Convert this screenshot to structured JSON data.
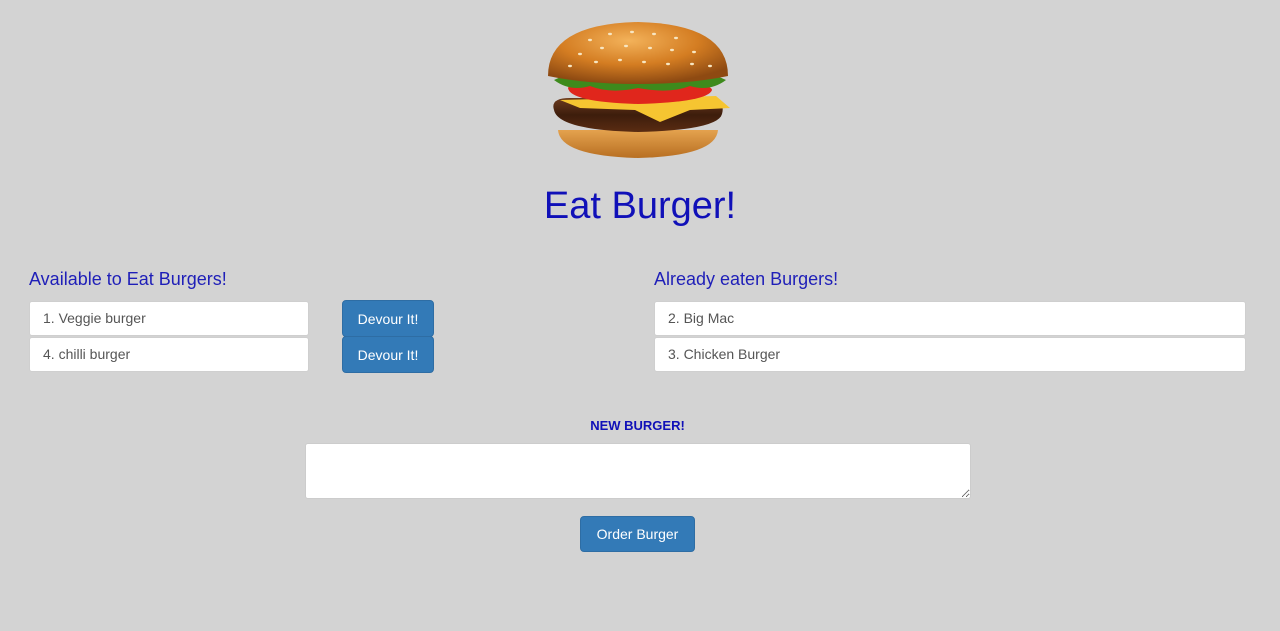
{
  "header": {
    "logo_icon": "burger-icon",
    "title": "Eat Burger!"
  },
  "available": {
    "heading": "Available to Eat Burgers!",
    "items": [
      {
        "label": "1. Veggie burger",
        "button": "Devour It!"
      },
      {
        "label": "4. chilli burger",
        "button": "Devour It!"
      }
    ]
  },
  "eaten": {
    "heading": "Already eaten Burgers!",
    "items": [
      {
        "label": "2. Big Mac"
      },
      {
        "label": "3. Chicken Burger"
      }
    ]
  },
  "form": {
    "label": "NEW BURGER!",
    "textarea_value": "",
    "submit_label": "Order Burger"
  },
  "colors": {
    "background": "#d3d3d3",
    "title_blue": "#1010b8",
    "button_blue": "#337ab7"
  }
}
